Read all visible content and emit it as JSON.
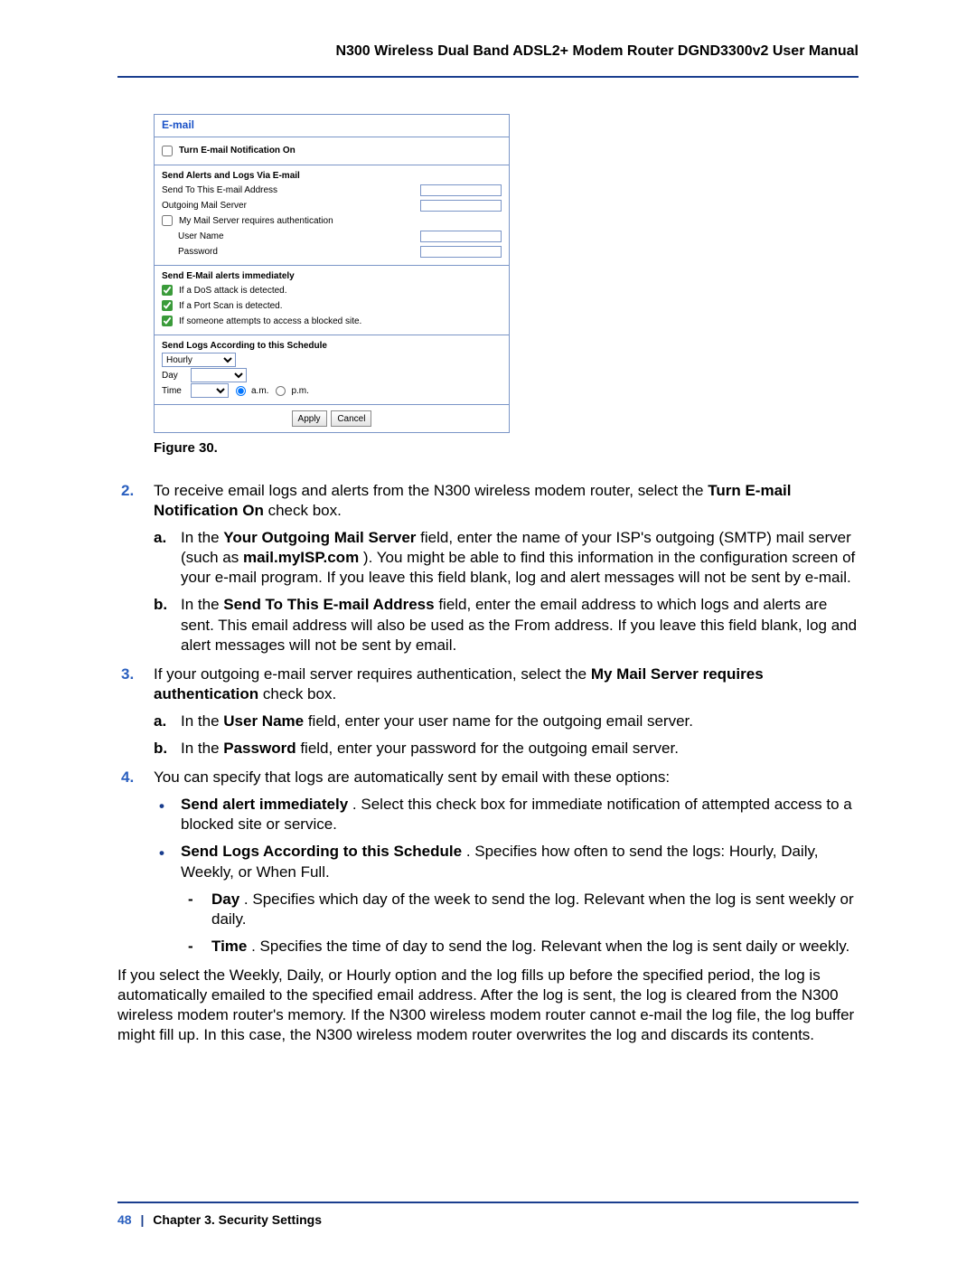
{
  "header": {
    "title": "N300 Wireless Dual Band ADSL2+ Modem Router DGND3300v2 User Manual"
  },
  "ui": {
    "title": "E-mail",
    "notif_label": "Turn E-mail Notification On",
    "sec1_head": "Send Alerts and Logs Via E-mail",
    "sendto_label": "Send To This E-mail Address",
    "smtp_label": "Outgoing Mail Server",
    "auth_label": "My Mail Server requires authentication",
    "user_label": "User Name",
    "pwd_label": "Password",
    "sec2_head": "Send E-Mail alerts immediately",
    "alert_dos": "If a DoS attack is detected.",
    "alert_port": "If a Port Scan is detected.",
    "alert_block": "If someone attempts to access a blocked site.",
    "sec3_head": "Send Logs According to this Schedule",
    "schedule_value": "Hourly",
    "day_label": "Day",
    "time_label": "Time",
    "am": "a.m.",
    "pm": "p.m.",
    "apply": "Apply",
    "cancel": "Cancel"
  },
  "figure_caption": "Figure 30.  ",
  "steps": {
    "s2": {
      "text_a": "To receive email logs and alerts from the N300 wireless modem router, select the ",
      "b1": "Turn E-mail Notification On",
      "text_b": " check box.",
      "a": {
        "pre": "In the ",
        "b1": "Your Outgoing Mail Server",
        "mid1": " field, enter the name of your ISP's outgoing (SMTP) mail server (such as ",
        "b2": "mail.myISP.com",
        "post": "). You might be able to find this information in the configuration screen of your e-mail program. If you leave this field blank, log and alert messages will not be sent by e-mail."
      },
      "b": {
        "pre": "In the ",
        "b1": "Send To This E-mail Address",
        "post": " field, enter the email address to which logs and alerts are sent. This email address will also be used as the From address. If you leave this field blank, log and alert messages will not be sent by email."
      }
    },
    "s3": {
      "pre": "If your outgoing e-mail server requires authentication, select the ",
      "b1": "My Mail Server requires authentication",
      "post": " check box.",
      "a": {
        "pre": "In the ",
        "b1": "User Name",
        "post": " field, enter your user name for the outgoing email server."
      },
      "b": {
        "pre": "In the ",
        "b1": "Password",
        "post": " field, enter your password for the outgoing email server."
      }
    },
    "s4": {
      "text": "You can specify that logs are automatically sent by email with these options:",
      "bul1": {
        "b1": "Send alert immediately",
        "post": ". Select this check box for immediate notification of attempted access to a blocked site or service."
      },
      "bul2": {
        "b1": "Send Logs According to this Schedule",
        "post": ". Specifies how often to send the logs: Hourly, Daily, Weekly, or When Full."
      },
      "d1": {
        "b1": "Day",
        "post": ". Specifies which day of the week to send the log. Relevant when the log is sent weekly or daily."
      },
      "d2": {
        "b1": "Time",
        "post": ". Specifies the time of day to send the log. Relevant when the log is sent daily or weekly."
      }
    },
    "trail": "If you select the Weekly, Daily, or Hourly option and the log fills up before the specified period, the log is automatically emailed to the specified email address. After the log is sent, the log is cleared from the N300 wireless modem router's memory. If the N300 wireless modem router cannot e-mail the log file, the log buffer might fill up. In this case, the N300 wireless modem router overwrites the log and discards its contents."
  },
  "footer": {
    "page": "48",
    "sep": "|",
    "chapter": "Chapter 3.  Security Settings"
  }
}
